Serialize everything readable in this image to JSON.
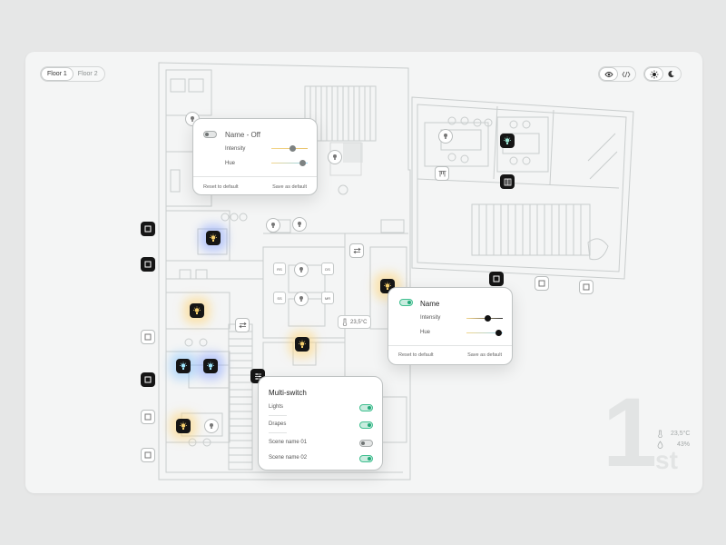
{
  "floors": {
    "tabs": [
      {
        "label": "Floor 1",
        "active": true
      },
      {
        "label": "Floor 2",
        "active": false
      }
    ]
  },
  "view_toggle": {
    "options": [
      "eye-icon",
      "code-icon"
    ],
    "active": "eye-icon"
  },
  "theme_toggle": {
    "options": [
      "sun-icon",
      "moon-icon"
    ],
    "active": "sun-icon"
  },
  "light_panel_off": {
    "name_state": "Name - Off",
    "on": false,
    "intensity_label": "Intensity",
    "hue_label": "Hue",
    "intensity": 0.58,
    "hue": 0.85,
    "reset_label": "Reset to default",
    "save_label": "Save as default"
  },
  "light_panel_on": {
    "name": "Name",
    "on": true,
    "intensity_label": "Intensity",
    "hue_label": "Hue",
    "intensity": 0.58,
    "hue": 0.88,
    "reset_label": "Reset to default",
    "save_label": "Save as default"
  },
  "multi_switch": {
    "title": "Multi-switch",
    "items": [
      {
        "label": "Lights",
        "on": true
      },
      {
        "label": "Drapes",
        "on": true
      },
      {
        "label": "Scene name 01",
        "on": false
      },
      {
        "label": "Scene name 02",
        "on": true
      }
    ]
  },
  "thermostat": {
    "reading": "23,5°C"
  },
  "floor_status": {
    "floor_number": "1",
    "floor_suffix": "st",
    "temperature": "23,5°C",
    "humidity": "43%"
  },
  "pads": [
    "RS",
    "DS",
    "SS",
    "MR"
  ],
  "colors": {
    "accent_on": "#23a878",
    "glow_yellow": "#ffd678",
    "glow_blue": "#7896ff",
    "device_dark": "#151515"
  }
}
